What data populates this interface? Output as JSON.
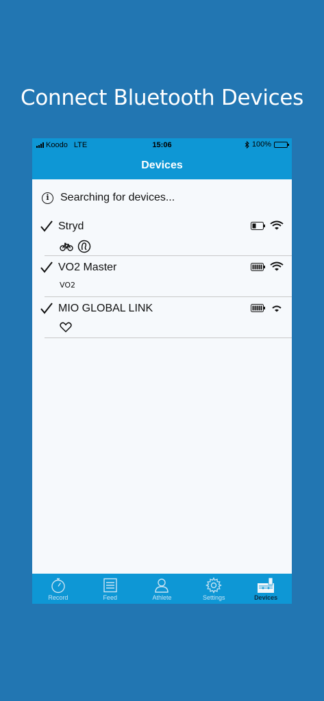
{
  "headline": "Connect Bluetooth Devices",
  "status_bar": {
    "carrier": "Koodo",
    "network": "LTE",
    "time": "15:06",
    "battery": "100%"
  },
  "nav": {
    "title": "Devices"
  },
  "search_status": "Searching for devices...",
  "devices": [
    {
      "name": "Stryd",
      "checked": true,
      "battery_level": 0.3,
      "signal": "strong",
      "capabilities": [
        "bike-icon",
        "power-icon"
      ]
    },
    {
      "name": "VO2 Master",
      "checked": true,
      "battery_level": 1.0,
      "signal": "strong",
      "sub_label": "VO2"
    },
    {
      "name": "MIO GLOBAL LINK",
      "checked": true,
      "battery_level": 1.0,
      "signal": "medium",
      "capabilities": [
        "heart-icon"
      ]
    }
  ],
  "tabs": [
    {
      "label": "Record",
      "icon": "stopwatch-icon",
      "active": false
    },
    {
      "label": "Feed",
      "icon": "feed-icon",
      "active": false
    },
    {
      "label": "Athlete",
      "icon": "athlete-icon",
      "active": false
    },
    {
      "label": "Settings",
      "icon": "gear-icon",
      "active": false
    },
    {
      "label": "Devices",
      "icon": "devices-icon",
      "active": true
    }
  ],
  "colors": {
    "background": "#2276b2",
    "bar": "#0e97d5",
    "content": "#f6f9fc"
  }
}
